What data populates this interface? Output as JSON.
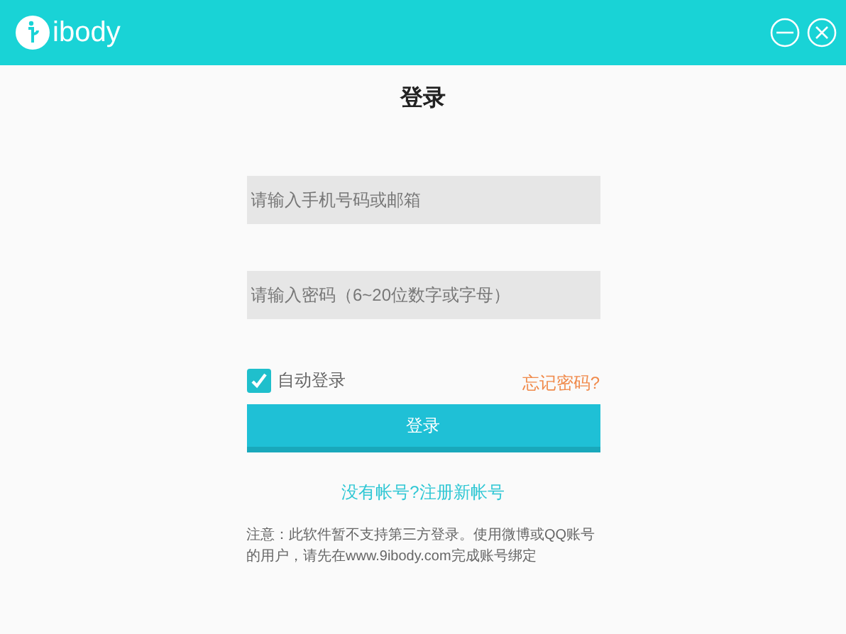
{
  "app": {
    "name": "ibody"
  },
  "window_controls": [
    {
      "kind": "minimize"
    },
    {
      "kind": "close"
    }
  ],
  "heading": "登录",
  "fields": [
    {
      "placeholder": "请输入手机号码或邮箱"
    },
    {
      "placeholder": "请输入密码（6~20位数字或字母）"
    }
  ],
  "auto_login": {
    "label": "自动登录",
    "checked": true
  },
  "forgot_link": "忘记密码?",
  "login_button": "登录",
  "register_link": "没有帐号?注册新帐号",
  "notice": "注意：此软件暂不支持第三方登录。使用微博或QQ账号的用户，请先在www.9ibody.com完成账号绑定"
}
